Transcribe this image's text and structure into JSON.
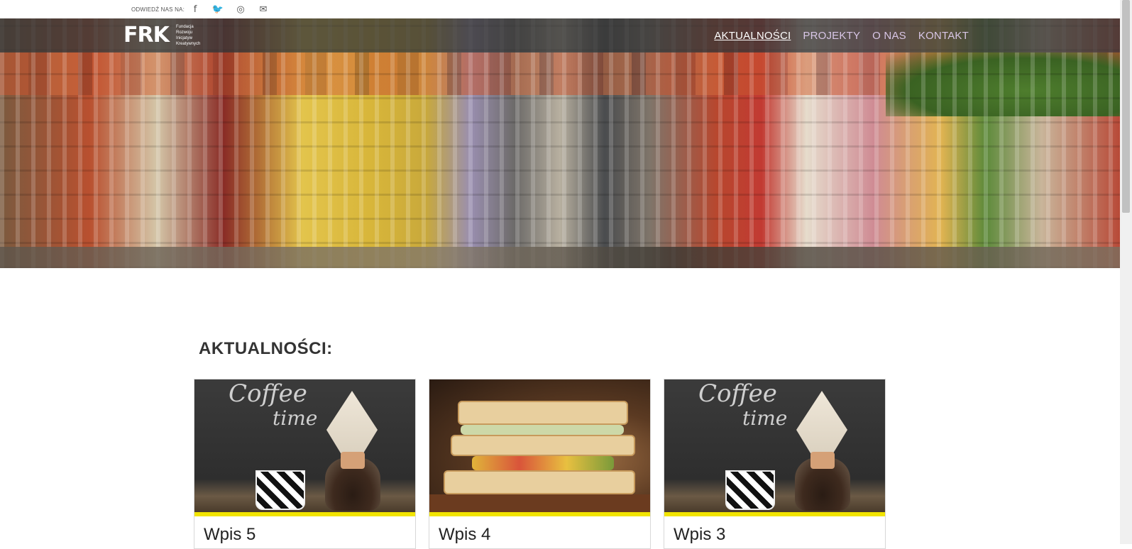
{
  "topbar": {
    "visit_label": "ODWIEDŹ NAS NA:",
    "social": [
      {
        "icon": "facebook-icon",
        "glyph": "f"
      },
      {
        "icon": "twitter-icon",
        "glyph": "🐦"
      },
      {
        "icon": "instagram-icon",
        "glyph": "◎"
      },
      {
        "icon": "mail-icon",
        "glyph": "✉"
      }
    ]
  },
  "header": {
    "logo_mark": "FRK",
    "logo_sub": [
      "Fundacja",
      "Rozwoju",
      "Inicjatyw",
      "Kreatywnych"
    ],
    "menu": [
      {
        "label": "AKTUALNOŚCI",
        "active": true
      },
      {
        "label": "PROJEKTY",
        "active": false
      },
      {
        "label": "O NAS",
        "active": false
      },
      {
        "label": "KONTAKT",
        "active": false
      }
    ]
  },
  "main": {
    "section_title": "AKTUALNOŚCI:",
    "cards": [
      {
        "title": "Wpis 5",
        "image": "coffee"
      },
      {
        "title": "Wpis 4",
        "image": "sandwich"
      },
      {
        "title": "Wpis 3",
        "image": "coffee"
      }
    ],
    "chalk_text_1": "Coffee",
    "chalk_text_2": "time"
  },
  "colors": {
    "accent_yellow": "#f2e400",
    "nav_bg": "#373737",
    "nav_link": "#d8c6e6"
  }
}
